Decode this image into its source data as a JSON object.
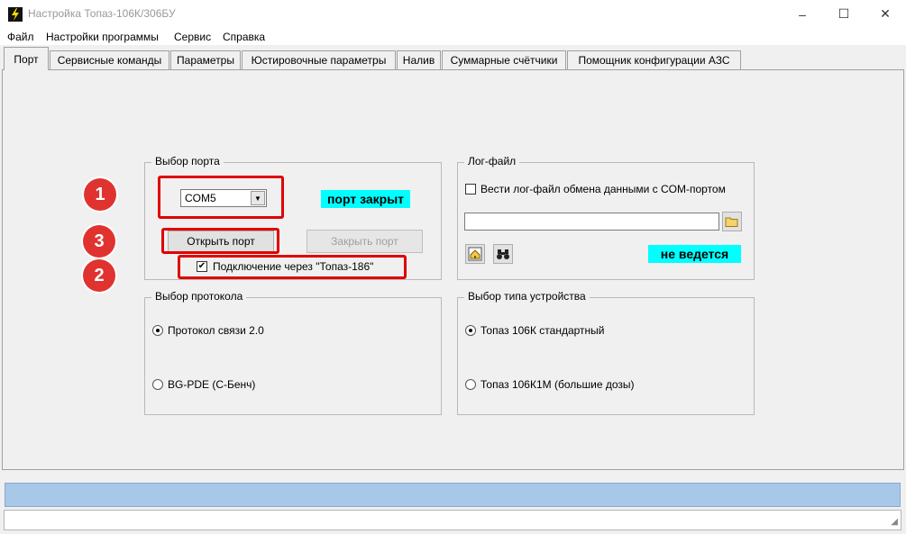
{
  "window": {
    "title": "Настройка Топаз-106К/306БУ",
    "minimize": "–",
    "maximize": "☐",
    "close": "✕"
  },
  "menu": [
    "Файл",
    "Настройки программы",
    "Сервис",
    "Справка"
  ],
  "tabs": [
    {
      "label": "Порт",
      "active": true
    },
    {
      "label": "Сервисные команды"
    },
    {
      "label": "Параметры"
    },
    {
      "label": "Юстировочные параметры"
    },
    {
      "label": "Налив"
    },
    {
      "label": "Суммарные счётчики"
    },
    {
      "label": "Помощник конфигурации АЗС"
    }
  ],
  "port_group": {
    "title": "Выбор порта",
    "combo_value": "COM5",
    "status": "порт закрыт",
    "status_color": "#00ffff",
    "open_button": "Открыть порт",
    "close_button": "Закрыть порт",
    "checkbox_label": "Подключение через \"Топаз-186\"",
    "checkbox_checked": true
  },
  "log_group": {
    "title": "Лог-файл",
    "checkbox_label": "Вести лог-файл обмена данными с COM-портом",
    "checkbox_checked": false,
    "path_value": "",
    "status": "не ведется",
    "icons": [
      "folder-icon",
      "home-icon",
      "binoculars-icon"
    ]
  },
  "protocol_group": {
    "title": "Выбор протокола",
    "options": [
      "Протокол связи 2.0",
      "BG-PDE (С-Бенч)"
    ],
    "selected": 0
  },
  "device_group": {
    "title": "Выбор типа устройства",
    "options": [
      "Топаз 106К стандартный",
      "Топаз 106К1М (большие дозы)"
    ],
    "selected": 0
  },
  "annotations": {
    "badges": [
      "1",
      "3",
      "2"
    ],
    "callout_color": "#e00000"
  }
}
